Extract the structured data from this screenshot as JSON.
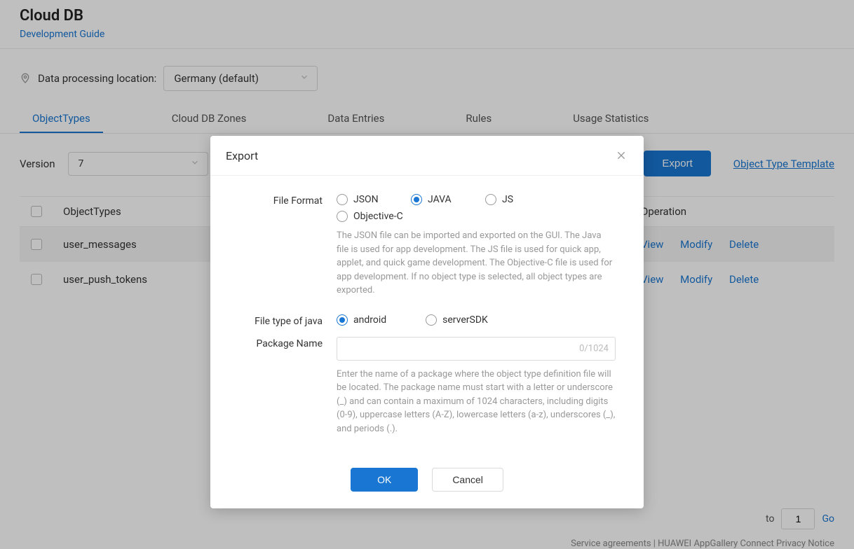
{
  "header": {
    "title": "Cloud DB",
    "subtitle": "Development Guide"
  },
  "location": {
    "label": "Data processing location:",
    "value": "Germany  (default)"
  },
  "tabs": [
    {
      "label": "ObjectTypes",
      "active": true
    },
    {
      "label": "Cloud DB Zones",
      "active": false
    },
    {
      "label": "Data Entries",
      "active": false
    },
    {
      "label": "Rules",
      "active": false
    },
    {
      "label": "Usage Statistics",
      "active": false
    }
  ],
  "toolbar": {
    "version_label": "Version",
    "version_value": "7",
    "export_label": "Export",
    "template_link": "Object Type Template"
  },
  "table": {
    "columns": {
      "name": "ObjectTypes",
      "operation": "Operation"
    },
    "op_labels": {
      "view": "View",
      "modify": "Modify",
      "delete": "Delete"
    },
    "rows": [
      {
        "name": "user_messages",
        "selected": true
      },
      {
        "name": "user_push_tokens",
        "selected": false
      }
    ]
  },
  "pager": {
    "to_label": "to",
    "page": "1",
    "go_label": "Go"
  },
  "footer": {
    "text": "Service agreements  |  HUAWEI AppGallery Connect Privacy Notice"
  },
  "modal": {
    "title": "Export",
    "file_format": {
      "label": "File Format",
      "options": [
        {
          "label": "JSON",
          "checked": false
        },
        {
          "label": "JAVA",
          "checked": true
        },
        {
          "label": "JS",
          "checked": false
        },
        {
          "label": "Objective-C",
          "checked": false
        }
      ],
      "help": "The JSON file can be imported and exported on the GUI. The Java file is used for app development. The JS file is used for quick app, applet, and quick game development. The Objective-C file is used for app development. If no object type is selected, all object types are exported."
    },
    "java_type": {
      "label": "File type of java",
      "options": [
        {
          "label": "android",
          "checked": true
        },
        {
          "label": "serverSDK",
          "checked": false
        }
      ]
    },
    "package_name": {
      "label": "Package Name",
      "value": "",
      "counter": "0/1024",
      "help": "Enter the name of a package where the object type definition file will be located. The package name must start with a letter or underscore (_) and can contain a maximum of 1024 characters, including digits (0-9), uppercase letters (A-Z), lowercase letters (a-z), underscores (_), and periods (.)."
    },
    "buttons": {
      "ok": "OK",
      "cancel": "Cancel"
    }
  }
}
